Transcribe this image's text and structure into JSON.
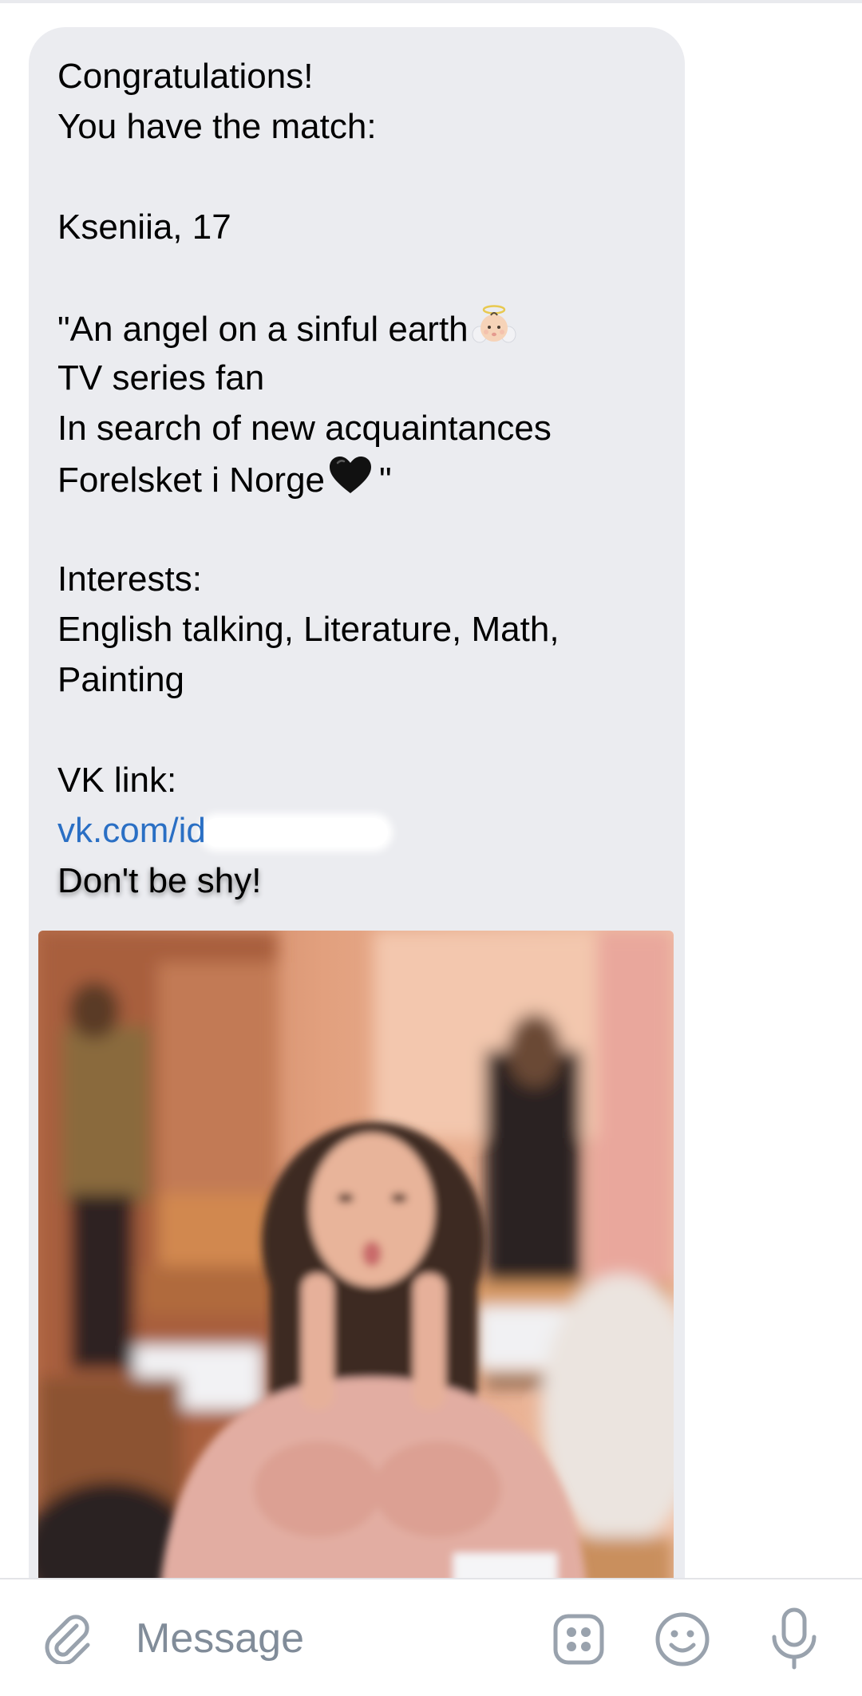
{
  "message": {
    "lines": {
      "congrats": "Congratulations!",
      "match_intro": "You have the match:",
      "name_age": "Kseniia, 17",
      "bio_1": "\"An angel on a sinful earth",
      "bio_1_emoji": "baby-angel-emoji",
      "bio_2": "TV series fan",
      "bio_3": "In search of new acquaintances",
      "bio_4": "Forelsket i Norge",
      "bio_4_emoji": "black-heart-emoji",
      "bio_4_end": "\"",
      "interests_label": "Interests:",
      "interests_1": "English talking, Literature, Math,",
      "interests_2": "Painting",
      "vk_label": "VK link:",
      "vk_link": "vk.com/id",
      "closing": "Don't be shy!"
    },
    "attachment": "photo"
  },
  "composer": {
    "placeholder": "Message",
    "icons": [
      "paperclip-icon",
      "apps-grid-icon",
      "emoji-smile-icon",
      "microphone-icon"
    ]
  },
  "colors": {
    "bubble": "#ebecf0",
    "link": "#2a6fc4",
    "placeholder": "#818c99",
    "icon": "#99a2ad"
  }
}
